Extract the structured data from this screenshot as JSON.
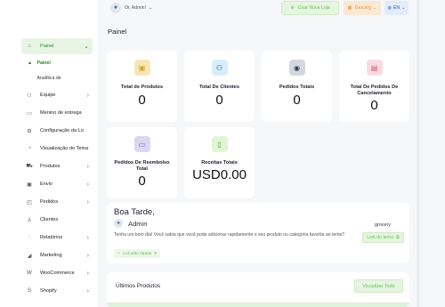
{
  "header": {
    "greeting": "Oi, Admin!",
    "create_store": "Criar Nova Loja",
    "store_switch": "Grocery",
    "lang": "EN"
  },
  "page_title": "Painel",
  "sidebar": {
    "items": [
      {
        "label": "Painel",
        "icon": "home-icon"
      },
      {
        "label": "Equipe",
        "icon": "team-icon"
      },
      {
        "label": "Menino de entrega",
        "icon": "delivery-icon"
      },
      {
        "label": "Configuração da Lo",
        "icon": "settings-icon"
      },
      {
        "label": "Visualização do Tema",
        "icon": "theme-icon"
      },
      {
        "label": "Produtos",
        "icon": "cart-icon"
      },
      {
        "label": "Envio",
        "icon": "truck-icon"
      },
      {
        "label": "Pedidos",
        "icon": "orders-icon"
      },
      {
        "label": "Clientes",
        "icon": "customers-icon"
      },
      {
        "label": "Relatórios",
        "icon": "chart-icon"
      },
      {
        "label": "Marketing",
        "icon": "megaphone-icon"
      },
      {
        "label": "WooCommerce",
        "icon": "woo-icon"
      },
      {
        "label": "Shopify",
        "icon": "shopify-icon"
      }
    ],
    "subitems": [
      "Painel",
      "Analítica de"
    ]
  },
  "stats": [
    {
      "label": "Total de Produtos",
      "value": "0",
      "color": "#f6e7b5"
    },
    {
      "label": "Total De Clientes",
      "value": "0",
      "color": "#d8eefa"
    },
    {
      "label": "Pedidos Totais",
      "value": "0",
      "color": "#d5d7de"
    },
    {
      "label": "Total De Pedidos De Cancelamento",
      "value": "0",
      "color": "#fadbe2"
    },
    {
      "label": "Pedidos De Reembolso Total",
      "value": "0",
      "color": "#dcd6f2"
    },
    {
      "label": "Receitas Totais",
      "value": "USD0.00",
      "color": "#dff5d6"
    }
  ],
  "welcome": {
    "title": "Boa Tarde,",
    "user": "Admin",
    "text": "Tenha um bom dia! Você sabia que você pode adicionar rapidamente o seu produto ou categoria favorita ao tema?",
    "quick": "Inclusão rápida",
    "store_name": "grocery",
    "link": "Link do tema"
  },
  "products": {
    "title": "Últimos Produtos",
    "view_all": "Visualizar Todo"
  }
}
